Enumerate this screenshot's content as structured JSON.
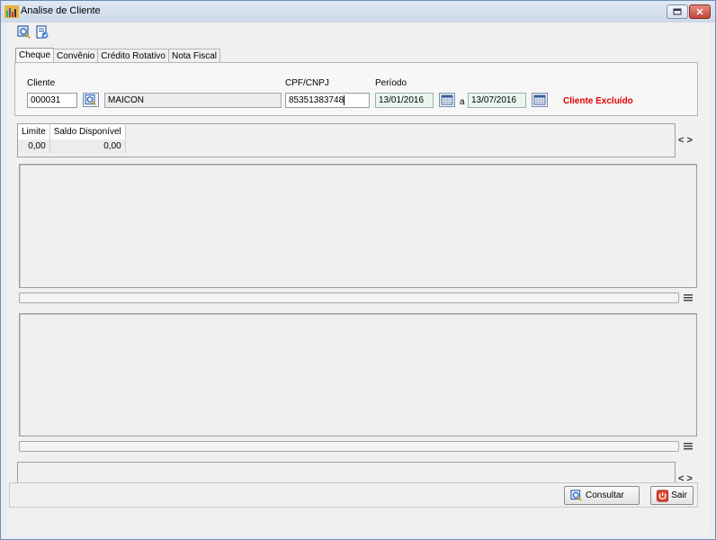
{
  "window": {
    "title": "Analise de Cliente"
  },
  "toolbar": {
    "icons": [
      "search-icon",
      "report-icon"
    ]
  },
  "tabs": [
    {
      "label": "Cheque",
      "active": true
    },
    {
      "label": "Convênio",
      "active": false
    },
    {
      "label": "Crédito Rotativo",
      "active": false
    },
    {
      "label": "Nota Fiscal",
      "active": false
    }
  ],
  "form": {
    "cliente_label": "Cliente",
    "cliente_code": "000031",
    "cliente_name": "MAICON",
    "cpf_label": "CPF/CNPJ",
    "cpf_value": "85351383748",
    "periodo_label": "Período",
    "date_from": "13/01/2016",
    "date_sep": "a",
    "date_to": "13/07/2016",
    "status": "Cliente Excluído",
    "status_color": "#e00000"
  },
  "summary": {
    "headers": [
      "Limite",
      "Saldo Disponível"
    ],
    "values": [
      "0,00",
      "0,00"
    ],
    "nav": "< >"
  },
  "bottom_panel": {
    "nav": "< >"
  },
  "footer": {
    "consultar_label": "Consultar",
    "sair_label": "Sair"
  }
}
